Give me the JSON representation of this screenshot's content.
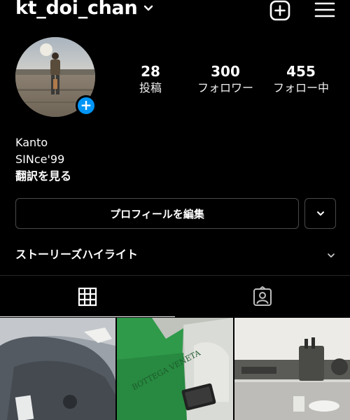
{
  "header": {
    "username": "kt_doi_chan",
    "icons": [
      "chevron-down-icon",
      "new-post-icon",
      "menu-icon"
    ]
  },
  "stats": {
    "posts": {
      "count": "28",
      "label": "投稿"
    },
    "followers": {
      "count": "300",
      "label": "フォロワー"
    },
    "following": {
      "count": "455",
      "label": "フォロー中"
    }
  },
  "bio": {
    "line1": "Kanto",
    "line2": "SINce'99",
    "translate": "翻訳を見る"
  },
  "buttons": {
    "edit_profile": "プロフィールを編集"
  },
  "highlights": {
    "title": "ストーリーズハイライト"
  },
  "tabs": [
    "grid-icon",
    "tagged-icon"
  ],
  "grid": {
    "tiles": [
      {
        "desc_icon": "photo-tile",
        "text": ""
      },
      {
        "desc_icon": "photo-tile",
        "text": "BOTTEGA VENETA"
      },
      {
        "desc_icon": "photo-tile",
        "text": ""
      }
    ]
  },
  "colors": {
    "background": "#000000",
    "accent": "#0095f6",
    "border": "#4a4a4a",
    "bag_green": "#2f9a4a"
  }
}
